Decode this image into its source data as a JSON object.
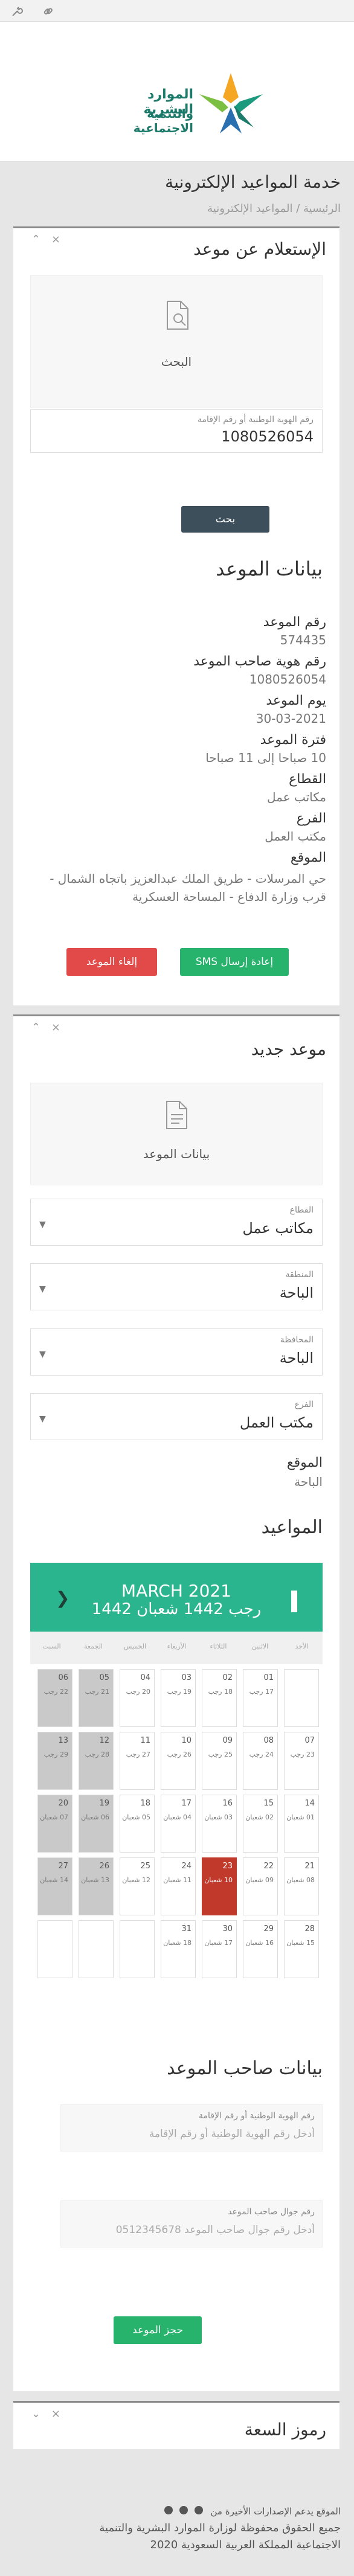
{
  "header": {
    "logo_line1": "الموارد البشرية",
    "logo_line2": "والتنمية الاجتماعية",
    "icons": [
      "wrench-icon",
      "link-icon"
    ]
  },
  "page": {
    "title": "خدمة المواعيد الإلكترونية",
    "breadcrumb": "الرئيسية / المواعيد الإلكترونية"
  },
  "inquiry": {
    "title": "الإستعلام عن موعد",
    "search_label": "البحث",
    "id_label": "رقم الهوية الوطنية أو رقم الإقامة",
    "id_value": "1080526054",
    "search_button": "بحث"
  },
  "appointment": {
    "title": "بيانات الموعد",
    "fields": [
      {
        "label": "رقم الموعد",
        "value": "574435"
      },
      {
        "label": "رقم هوية صاحب الموعد",
        "value": "1080526054"
      },
      {
        "label": "يوم الموعد",
        "value": "30-03-2021"
      },
      {
        "label": "فترة الموعد",
        "value": "10 صباحا إلى 11 صباحا"
      },
      {
        "label": "القطاع",
        "value": "مكاتب عمل"
      },
      {
        "label": "الفرع",
        "value": "مكتب العمل"
      },
      {
        "label": "الموقع",
        "value": "حي المرسلات - طريق الملك عبدالعزيز باتجاه الشمال - قرب وزارة الدفاع - المساحة العسكرية"
      }
    ],
    "resend_sms": "إعادة إرسال SMS",
    "cancel": "إلغاء الموعد"
  },
  "new_appointment": {
    "title": "موعد جديد",
    "data_label": "بيانات الموعد",
    "selects": [
      {
        "label": "القطاع",
        "value": "مكاتب عمل"
      },
      {
        "label": "المنطقة",
        "value": "الباحة"
      },
      {
        "label": "المحافظة",
        "value": "الباحة"
      },
      {
        "label": "الفرع",
        "value": "مكتب العمل"
      }
    ],
    "location_label": "الموقع",
    "location_value": "الباحة",
    "appointments_title": "المواعيد"
  },
  "calendar": {
    "month_greg": "MARCH 2021",
    "month_hijri": "رجب 1442 شعبان 1442",
    "weekdays": [
      "الأحد",
      "الاثنين",
      "الثلاثاء",
      "الأربعاء",
      "الخميس",
      "الجمعة",
      "السبت"
    ],
    "weeks": [
      [
        {
          "g": "",
          "h": ""
        },
        {
          "g": "01",
          "h": "17 رجب"
        },
        {
          "g": "02",
          "h": "18 رجب"
        },
        {
          "g": "03",
          "h": "19 رجب"
        },
        {
          "g": "04",
          "h": "20 رجب"
        },
        {
          "g": "05",
          "h": "21 رجب"
        },
        {
          "g": "06",
          "h": "22 رجب"
        }
      ],
      [
        {
          "g": "07",
          "h": "23 رجب"
        },
        {
          "g": "08",
          "h": "24 رجب"
        },
        {
          "g": "09",
          "h": "25 رجب"
        },
        {
          "g": "10",
          "h": "26 رجب"
        },
        {
          "g": "11",
          "h": "27 رجب"
        },
        {
          "g": "12",
          "h": "28 رجب"
        },
        {
          "g": "13",
          "h": "29 رجب"
        }
      ],
      [
        {
          "g": "14",
          "h": "01 شعبان"
        },
        {
          "g": "15",
          "h": "02 شعبان"
        },
        {
          "g": "16",
          "h": "03 شعبان"
        },
        {
          "g": "17",
          "h": "04 شعبان"
        },
        {
          "g": "18",
          "h": "05 شعبان"
        },
        {
          "g": "19",
          "h": "06 شعبان"
        },
        {
          "g": "20",
          "h": "07 شعبان"
        }
      ],
      [
        {
          "g": "21",
          "h": "08 شعبان"
        },
        {
          "g": "22",
          "h": "09 شعبان"
        },
        {
          "g": "23",
          "h": "10 شعبان"
        },
        {
          "g": "24",
          "h": "11 شعبان"
        },
        {
          "g": "25",
          "h": "12 شعبان"
        },
        {
          "g": "26",
          "h": "13 شعبان"
        },
        {
          "g": "27",
          "h": "14 شعبان"
        }
      ],
      [
        {
          "g": "28",
          "h": "15 شعبان"
        },
        {
          "g": "29",
          "h": "16 شعبان"
        },
        {
          "g": "30",
          "h": "17 شعبان"
        },
        {
          "g": "31",
          "h": "18 شعبان"
        },
        {
          "g": "",
          "h": ""
        },
        {
          "g": "",
          "h": ""
        },
        {
          "g": "",
          "h": ""
        }
      ]
    ]
  },
  "owner": {
    "title": "بيانات صاحب الموعد",
    "id_label": "رقم الهوية الوطنية أو رقم الإقامة",
    "id_placeholder": "أدخل رقم الهوية الوطنية أو رقم الإقامة",
    "mobile_label": "رقم جوال صاحب الموعد",
    "mobile_placeholder": "أدخل رقم جوال صاحب الموعد 0512345678",
    "book_button": "حجز الموعد"
  },
  "qr": {
    "title": "رموز السعة"
  },
  "footer": {
    "browsers_note": "الموقع يدعم الإصدارات الأخيرة من",
    "copyright_line1": "جميع الحقوق محفوظة لوزارة الموارد البشرية والتنمية",
    "copyright_line2": "الاجتماعية المملكة العربية السعودية 2020"
  }
}
